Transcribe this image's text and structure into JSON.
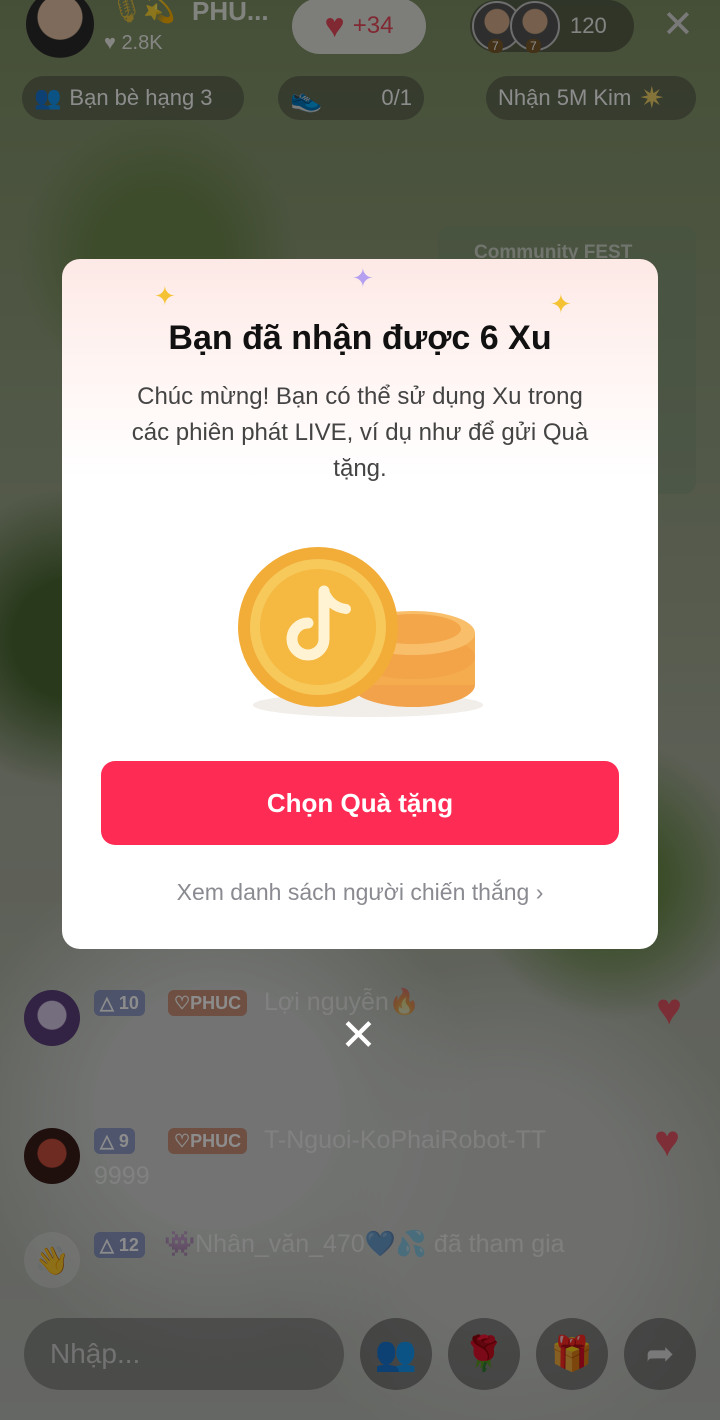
{
  "host": {
    "name": "PHU...",
    "likes": "2.8K"
  },
  "hearts": {
    "count": "+34"
  },
  "viewers": {
    "count": "120",
    "badges": [
      "7",
      "7"
    ]
  },
  "chips": {
    "friends": "Bạn bè hạng 3",
    "task": "0/1",
    "reward": "Nhận 5M Kim"
  },
  "banner": {
    "label": "Community FEST"
  },
  "modal": {
    "title": "Bạn đã nhận được 6 Xu",
    "description": "Chúc mừng! Bạn có thể sử dụng Xu trong các phiên phát LIVE, ví dụ như để gửi Quà tặng.",
    "cta": "Chọn Quà tặng",
    "winners_link": "Xem danh sách người chiến thắng ›"
  },
  "chat": [
    {
      "level": "10",
      "fan": "PHUC",
      "text": "Lợi nguyễn🔥",
      "extra": ""
    },
    {
      "level": "9",
      "fan": "PHUC",
      "text": "T-Nguoi-KoPhaiRobot-TT",
      "extra": "9999"
    },
    {
      "level": "12",
      "fan": "",
      "text": "👾Nhân_văn_470💙💦 đã tham gia",
      "extra": ""
    }
  ],
  "input": {
    "placeholder": "Nhập..."
  },
  "icons": {
    "close": "close-icon",
    "heart": "heart-icon",
    "friends": "friends-icon",
    "gift": "gift-icon",
    "rose": "rose-icon",
    "share": "share-icon"
  },
  "colors": {
    "accent": "#fe2c55",
    "heart": "#e84a5c",
    "gold": "#f4c232"
  }
}
